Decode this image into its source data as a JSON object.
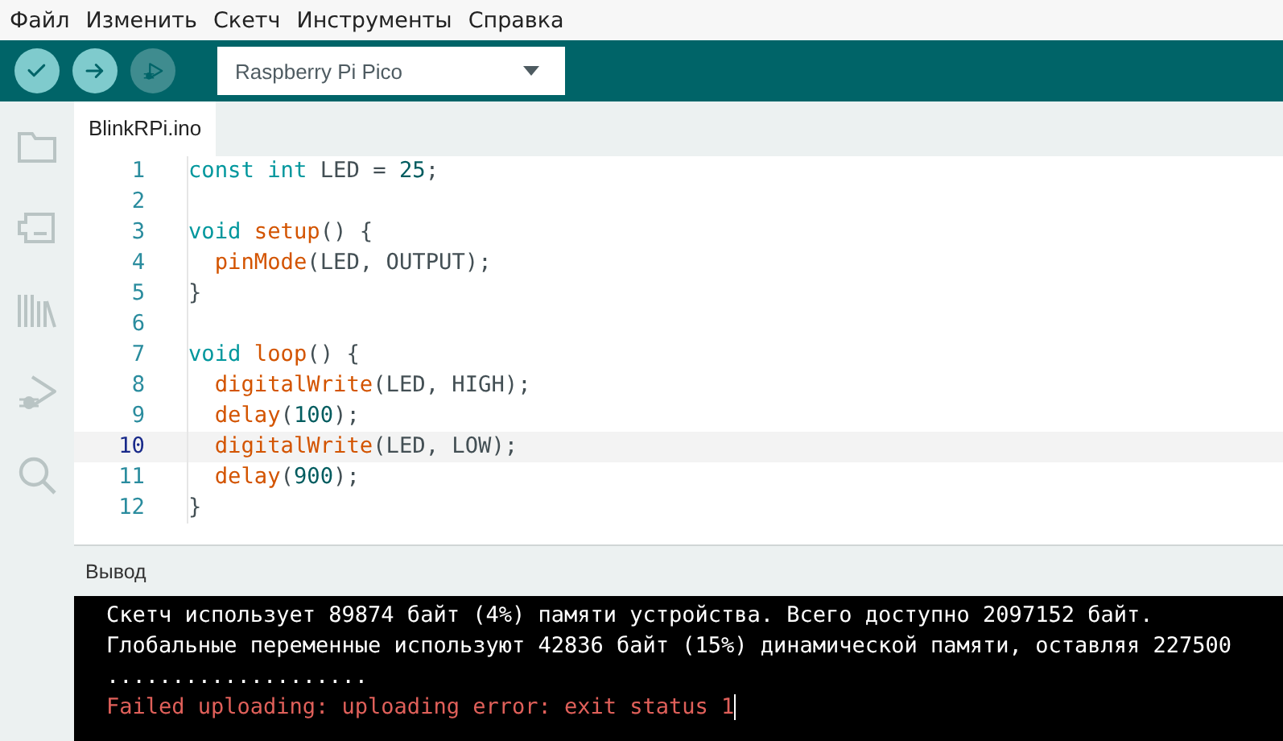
{
  "menu": [
    "Файл",
    "Изменить",
    "Скетч",
    "Инструменты",
    "Справка"
  ],
  "toolbar": {
    "buttons": [
      {
        "kind": "verify",
        "disabled": false
      },
      {
        "kind": "upload",
        "disabled": false
      },
      {
        "kind": "debug",
        "disabled": true
      }
    ],
    "board": "Raspberry Pi Pico"
  },
  "tabs": [
    {
      "label": "BlinkRPi.ino",
      "selected": true
    }
  ],
  "code": [
    {
      "number": "1",
      "selected": false,
      "tokens": [
        {
          "kind": "keyword",
          "text": "const"
        },
        {
          "kind": "keyword",
          "text": " int"
        },
        {
          "kind": "plain",
          "text": " LED = "
        },
        {
          "kind": "number",
          "text": "25"
        },
        {
          "kind": "plain",
          "text": ";"
        }
      ]
    },
    {
      "number": "2",
      "selected": false
    },
    {
      "number": "3",
      "selected": false,
      "tokens": [
        {
          "kind": "keyword",
          "text": "void"
        },
        {
          "kind": "function",
          "text": " setup"
        },
        {
          "kind": "plain",
          "text": "() {"
        }
      ]
    },
    {
      "number": "4",
      "selected": false,
      "tokens": [
        {
          "kind": "function",
          "text": "  pinMode"
        },
        {
          "kind": "plain",
          "text": "(LED, OUTPUT);"
        }
      ]
    },
    {
      "number": "5",
      "selected": false,
      "tokens": [
        {
          "kind": "plain",
          "text": "}"
        }
      ]
    },
    {
      "number": "6",
      "selected": false
    },
    {
      "number": "7",
      "selected": false,
      "tokens": [
        {
          "kind": "keyword",
          "text": "void"
        },
        {
          "kind": "function",
          "text": " loop"
        },
        {
          "kind": "plain",
          "text": "() {"
        }
      ]
    },
    {
      "number": "8",
      "selected": false,
      "tokens": [
        {
          "kind": "function",
          "text": "  digitalWrite"
        },
        {
          "kind": "plain",
          "text": "(LED, HIGH);"
        }
      ]
    },
    {
      "number": "9",
      "selected": false,
      "tokens": [
        {
          "kind": "function",
          "text": "  delay"
        },
        {
          "kind": "plain",
          "text": "("
        },
        {
          "kind": "number",
          "text": "100"
        },
        {
          "kind": "plain",
          "text": ");"
        }
      ]
    },
    {
      "number": "10",
      "selected": true,
      "tokens": [
        {
          "kind": "function",
          "text": "  digitalWrite"
        },
        {
          "kind": "plain",
          "text": "(LED, LOW);"
        }
      ]
    },
    {
      "number": "11",
      "selected": false,
      "tokens": [
        {
          "kind": "function",
          "text": "  delay"
        },
        {
          "kind": "plain",
          "text": "("
        },
        {
          "kind": "number",
          "text": "900"
        },
        {
          "kind": "plain",
          "text": ");"
        }
      ]
    },
    {
      "number": "12",
      "selected": false,
      "tokens": [
        {
          "kind": "plain",
          "text": "}"
        }
      ]
    }
  ],
  "output": {
    "title": "Вывод",
    "lines": [
      {
        "kind": "info",
        "text": "Скетч использует 89874 байт (4%) памяти устройства. Всего доступно 2097152 байт."
      },
      {
        "kind": "info",
        "text": "Глобальные переменные используют 42836 байт (15%) динамической памяти, оставляя 227500"
      },
      {
        "kind": "info",
        "text": "...................."
      },
      {
        "kind": "error",
        "text": "Failed uploading: uploading error: exit status 1"
      }
    ]
  }
}
